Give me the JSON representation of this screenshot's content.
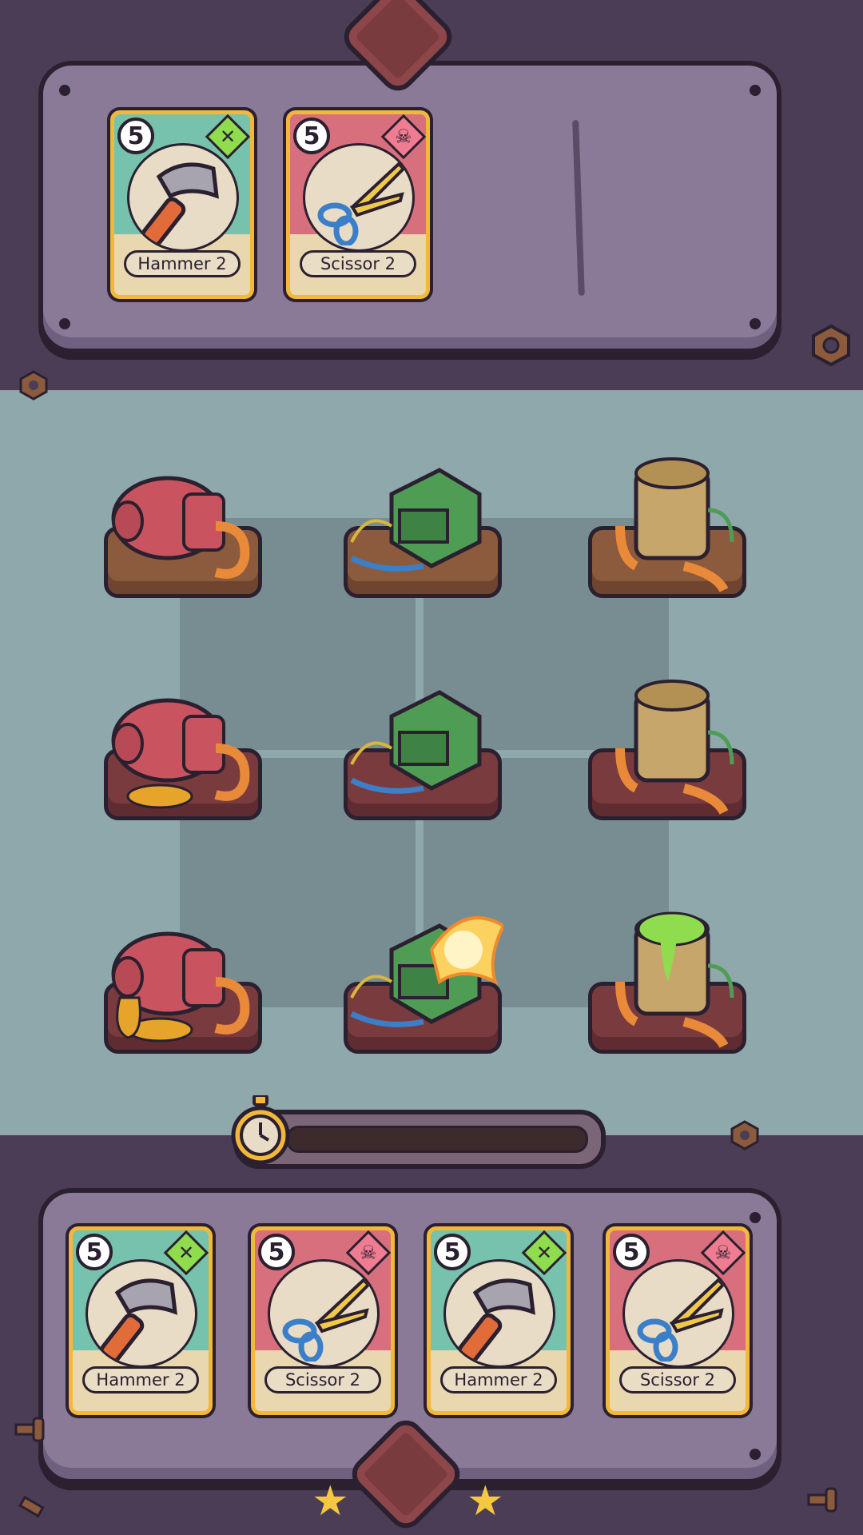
{
  "played_cards": [
    {
      "cost": "5",
      "name": "Hammer 2",
      "type_icon": "wrench-icon",
      "color": "green",
      "art": "hammer"
    },
    {
      "cost": "5",
      "name": "Scissor 2",
      "type_icon": "skull-icon",
      "color": "pink",
      "art": "scissors"
    }
  ],
  "hand_cards": [
    {
      "cost": "5",
      "name": "Hammer 2",
      "type_icon": "wrench-icon",
      "color": "green",
      "art": "hammer"
    },
    {
      "cost": "5",
      "name": "Scissor 2",
      "type_icon": "skull-icon",
      "color": "pink",
      "art": "scissors"
    },
    {
      "cost": "5",
      "name": "Hammer 2",
      "type_icon": "wrench-icon",
      "color": "green",
      "art": "hammer"
    },
    {
      "cost": "5",
      "name": "Scissor 2",
      "type_icon": "skull-icon",
      "color": "pink",
      "art": "scissors"
    }
  ],
  "board": [
    [
      "red-tank-machine-intact",
      "green-generator-machine-intact",
      "tan-boiler-machine-intact"
    ],
    [
      "red-tank-machine-leaking",
      "green-generator-machine-worn",
      "tan-boiler-machine-cracked"
    ],
    [
      "red-tank-machine-broken",
      "green-generator-machine-burning",
      "tan-boiler-machine-overflowing"
    ]
  ],
  "timer": {
    "icon": "stopwatch-icon"
  },
  "stars": {
    "count": 2,
    "icon": "star-icon"
  },
  "colors": {
    "accent_gold": "#f3b83a",
    "green_band": "#76c2ad",
    "pink_band": "#d86f7d"
  }
}
